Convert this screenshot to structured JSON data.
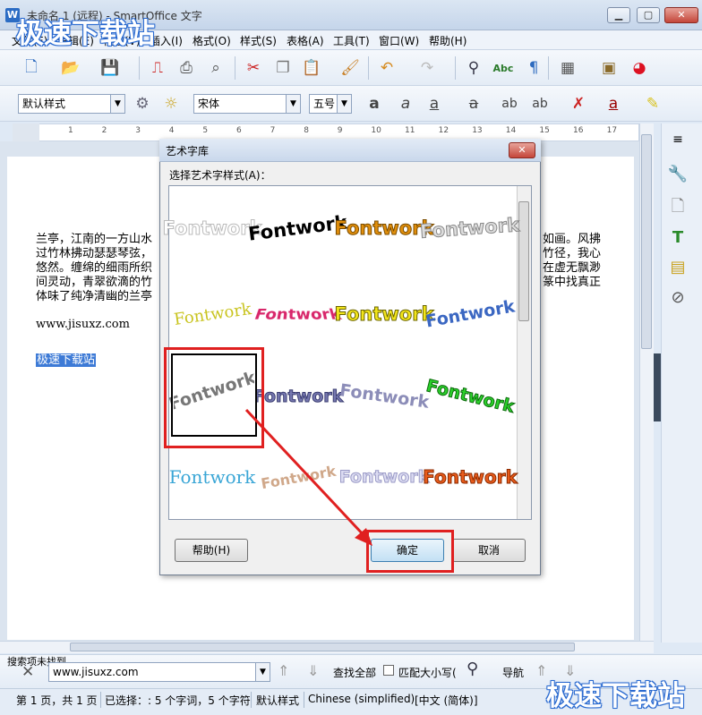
{
  "window": {
    "title": "未命名 1 (远程) - SmartOffice 文字",
    "buttons": {
      "minimize": "▁",
      "maximize": "▢",
      "close": "✕"
    }
  },
  "menu": {
    "items": [
      "文件(F)",
      "编辑(E)",
      "视图(V)",
      "插入(I)",
      "格式(O)",
      "样式(S)",
      "表格(A)",
      "工具(T)",
      "窗口(W)",
      "帮助(H)"
    ]
  },
  "toolbar2": {
    "style_value": "默认样式",
    "font_value": "宋体",
    "size_value": "五号"
  },
  "ruler": {
    "numbers": [
      "1",
      "2",
      "3",
      "4",
      "5",
      "6",
      "7",
      "8",
      "9",
      "10",
      "11",
      "12",
      "13",
      "14",
      "15",
      "16",
      "17"
    ]
  },
  "document": {
    "lines": [
      "兰亭，江南的一方山水",
      "过竹林拂动瑟瑟琴弦，",
      "悠然。缠绵的细雨所织",
      "间灵动，青翠欲滴的竹",
      "体味了纯净清幽的兰亭"
    ],
    "right_fragments": [
      "如画。风拂",
      "竹径，我心",
      "在虚无飘渺",
      "篆中找真正"
    ],
    "url_line": "www.jisuxz.com",
    "link_text": "极速下载站"
  },
  "dialog": {
    "title": "艺术字库",
    "prompt_label": "选择艺术字样式(A)：",
    "gallery": {
      "sample_text": "Fontwork",
      "selected_index": 8
    },
    "help_button": "帮助(H)",
    "ok_button": "确定",
    "cancel_button": "取消"
  },
  "searchbar": {
    "hint": "搜索项未找到",
    "value": "www.jisuxz.com",
    "find_all": "查找全部",
    "match_case": "匹配大小写(",
    "navigate": "导航"
  },
  "statusbar": {
    "page": "第 1 页，共 1 页",
    "selection": "已选择：: 5 个字词，5 个字符",
    "style": "默认样式",
    "language": "Chinese (simplified)",
    "lang_bracket": "[中文 (简体)]"
  },
  "watermark": {
    "top_left": "极速下载站",
    "bottom_right": "极速下载站"
  },
  "colors": {
    "accent": "#3d7ad6",
    "highlight_red": "#e02020"
  },
  "icons": [
    "new-doc-icon",
    "open-folder-icon",
    "save-icon",
    "export-pdf-icon",
    "print-icon",
    "print-preview-icon",
    "cut-icon",
    "copy-icon",
    "paste-icon",
    "format-painter-icon",
    "undo-icon",
    "redo-icon",
    "find-replace-icon",
    "spellcheck-icon",
    "pilcrow-icon",
    "table-icon",
    "picture-icon",
    "chart-icon"
  ]
}
